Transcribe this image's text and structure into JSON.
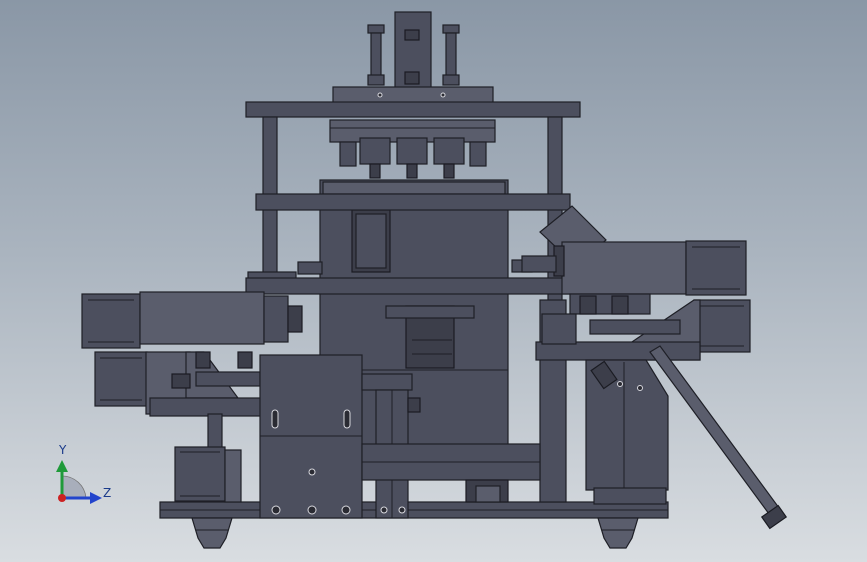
{
  "viewport": {
    "background_top": "#8a97a6",
    "background_bottom": "#d9dde1",
    "model_color": "#4c4f5e"
  },
  "triad": {
    "y_label": "Y",
    "z_label": "Z",
    "y_color": "#1f9a3a",
    "z_color": "#2244cc",
    "origin_color": "#cc2222"
  }
}
